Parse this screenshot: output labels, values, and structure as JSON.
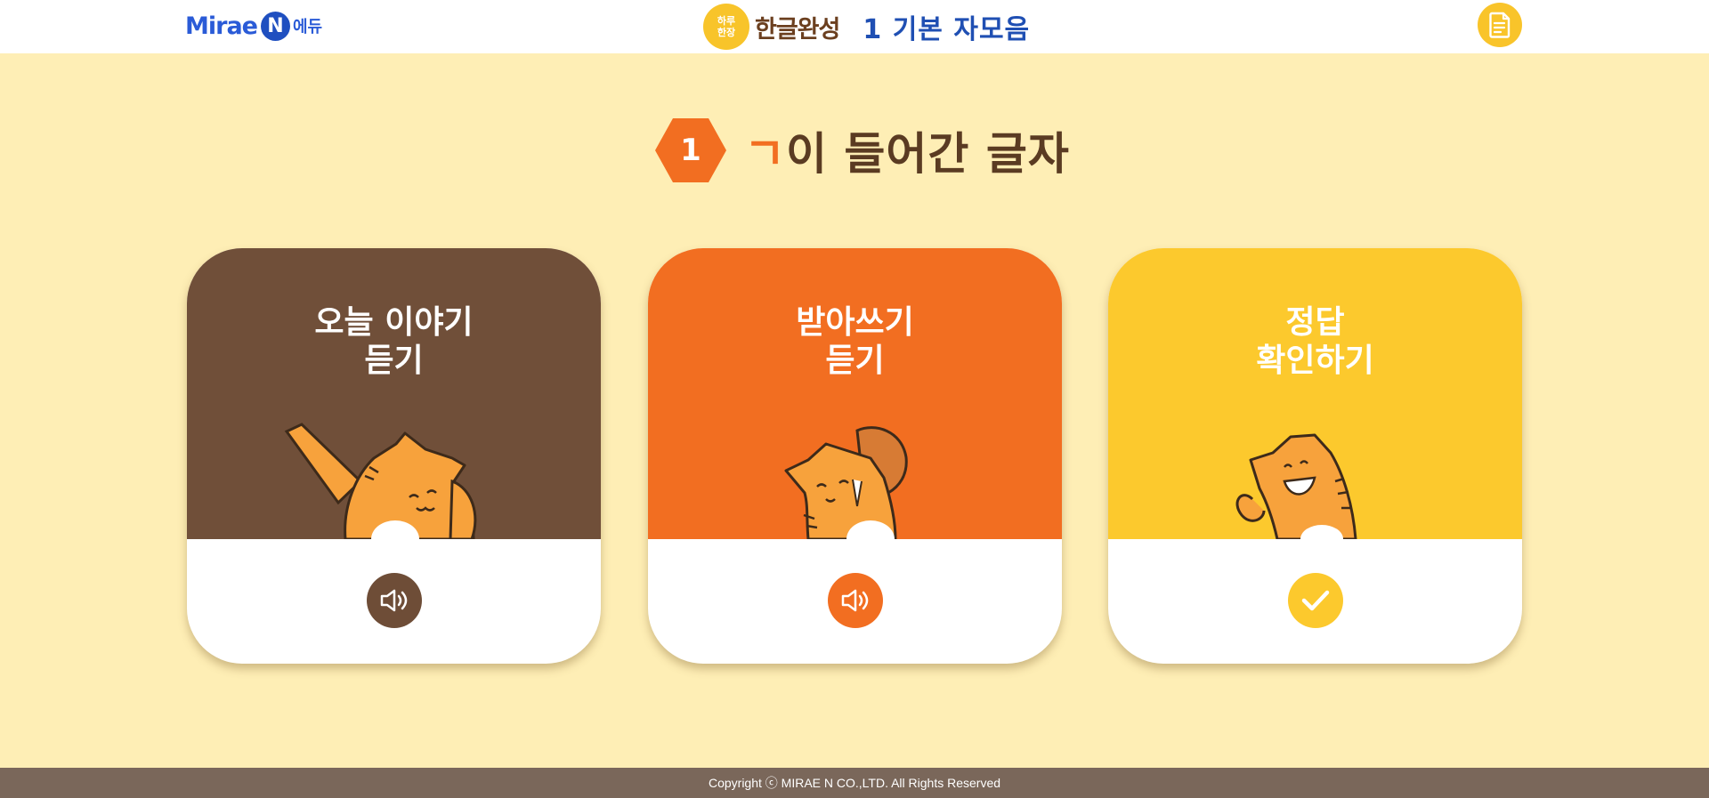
{
  "header": {
    "logo": {
      "mirae": "Mirae",
      "n": "N",
      "edu": "에듀"
    },
    "brand": {
      "badge": "하루\n한장",
      "name": "한글완성"
    },
    "title": "1 기본 자모음",
    "doc_icon": "document-icon"
  },
  "main": {
    "lesson_number": "1",
    "title_accent": "ㄱ",
    "title_rest": "이 들어간 글자"
  },
  "cards": [
    {
      "label": "오늘 이야기\n듣기",
      "color": "#704f39",
      "button_color": "#6e4d37",
      "icon": "speaker-icon"
    },
    {
      "label": "받아쓰기\n듣기",
      "color": "#f26e21",
      "button_color": "#f26e21",
      "icon": "speaker-icon"
    },
    {
      "label": "정답\n확인하기",
      "color": "#fcc92d",
      "button_color": "#fcc92d",
      "icon": "check-icon"
    }
  ],
  "footer": {
    "copyright": "Copyright ⓒ MIRAE N CO.,LTD. All Rights Reserved"
  }
}
